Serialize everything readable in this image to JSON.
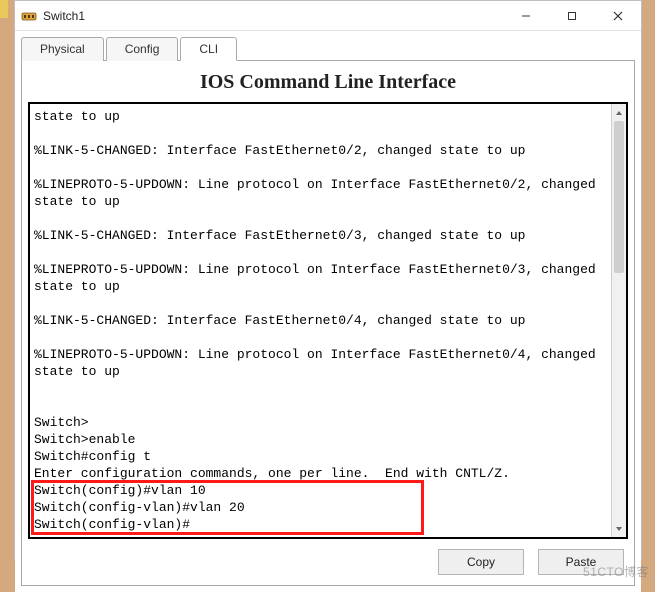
{
  "window": {
    "title": "Switch1"
  },
  "tabs": {
    "physical": "Physical",
    "config": "Config",
    "cli": "CLI"
  },
  "cli": {
    "heading": "IOS Command Line Interface",
    "output": "state to up\n\n%LINK-5-CHANGED: Interface FastEthernet0/2, changed state to up\n\n%LINEPROTO-5-UPDOWN: Line protocol on Interface FastEthernet0/2, changed state to up\n\n%LINK-5-CHANGED: Interface FastEthernet0/3, changed state to up\n\n%LINEPROTO-5-UPDOWN: Line protocol on Interface FastEthernet0/3, changed state to up\n\n%LINK-5-CHANGED: Interface FastEthernet0/4, changed state to up\n\n%LINEPROTO-5-UPDOWN: Line protocol on Interface FastEthernet0/4, changed state to up\n\n\nSwitch>\nSwitch>enable\nSwitch#config t\nEnter configuration commands, one per line.  End with CNTL/Z.\nSwitch(config)#vlan 10\nSwitch(config-vlan)#vlan 20\nSwitch(config-vlan)#"
  },
  "buttons": {
    "copy": "Copy",
    "paste": "Paste"
  },
  "watermark": "51CTO博客"
}
